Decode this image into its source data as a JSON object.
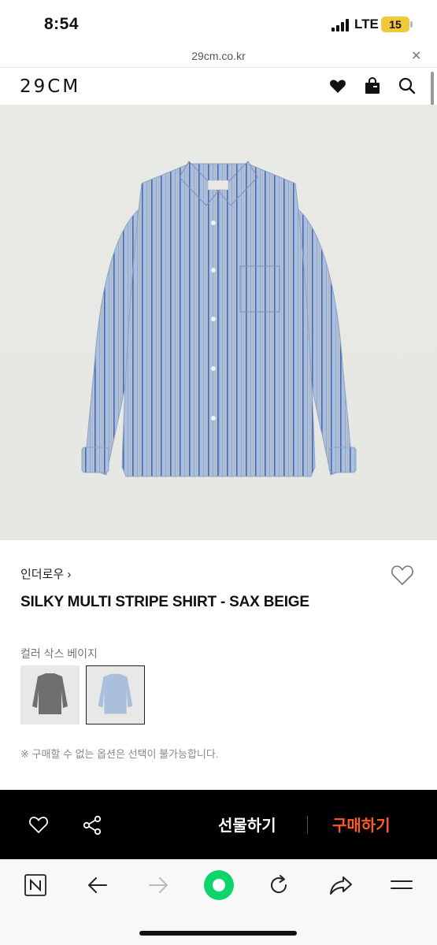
{
  "status_bar": {
    "time": "8:54",
    "network": "LTE",
    "battery": "15"
  },
  "url_bar": {
    "url": "29cm.co.kr",
    "close_icon": "close-icon"
  },
  "header": {
    "logo": "29CM",
    "icons": [
      "heart-icon",
      "shopping-bag-icon",
      "search-icon"
    ]
  },
  "product": {
    "brand": "인더로우 ›",
    "name": "SILKY MULTI STRIPE SHIRT - SAX BEIGE",
    "color_label": "컬러  삭스 베이지",
    "notice": "※ 구매할 수 없는 옵션은 선택이 불가능합니다."
  },
  "action_bar": {
    "gift_label": "선물하기",
    "buy_label": "구매하기",
    "buy_color": "#ff5a1f"
  },
  "browser_bar": {
    "icons": [
      "naver-n-icon",
      "back-arrow-icon",
      "forward-arrow-icon",
      "green-dot-icon",
      "refresh-icon",
      "share-icon",
      "menu-icon"
    ]
  },
  "colors": {
    "accent": "#ff5a1f",
    "battery": "#f0c93a",
    "shirt": "#a9bfdc"
  }
}
